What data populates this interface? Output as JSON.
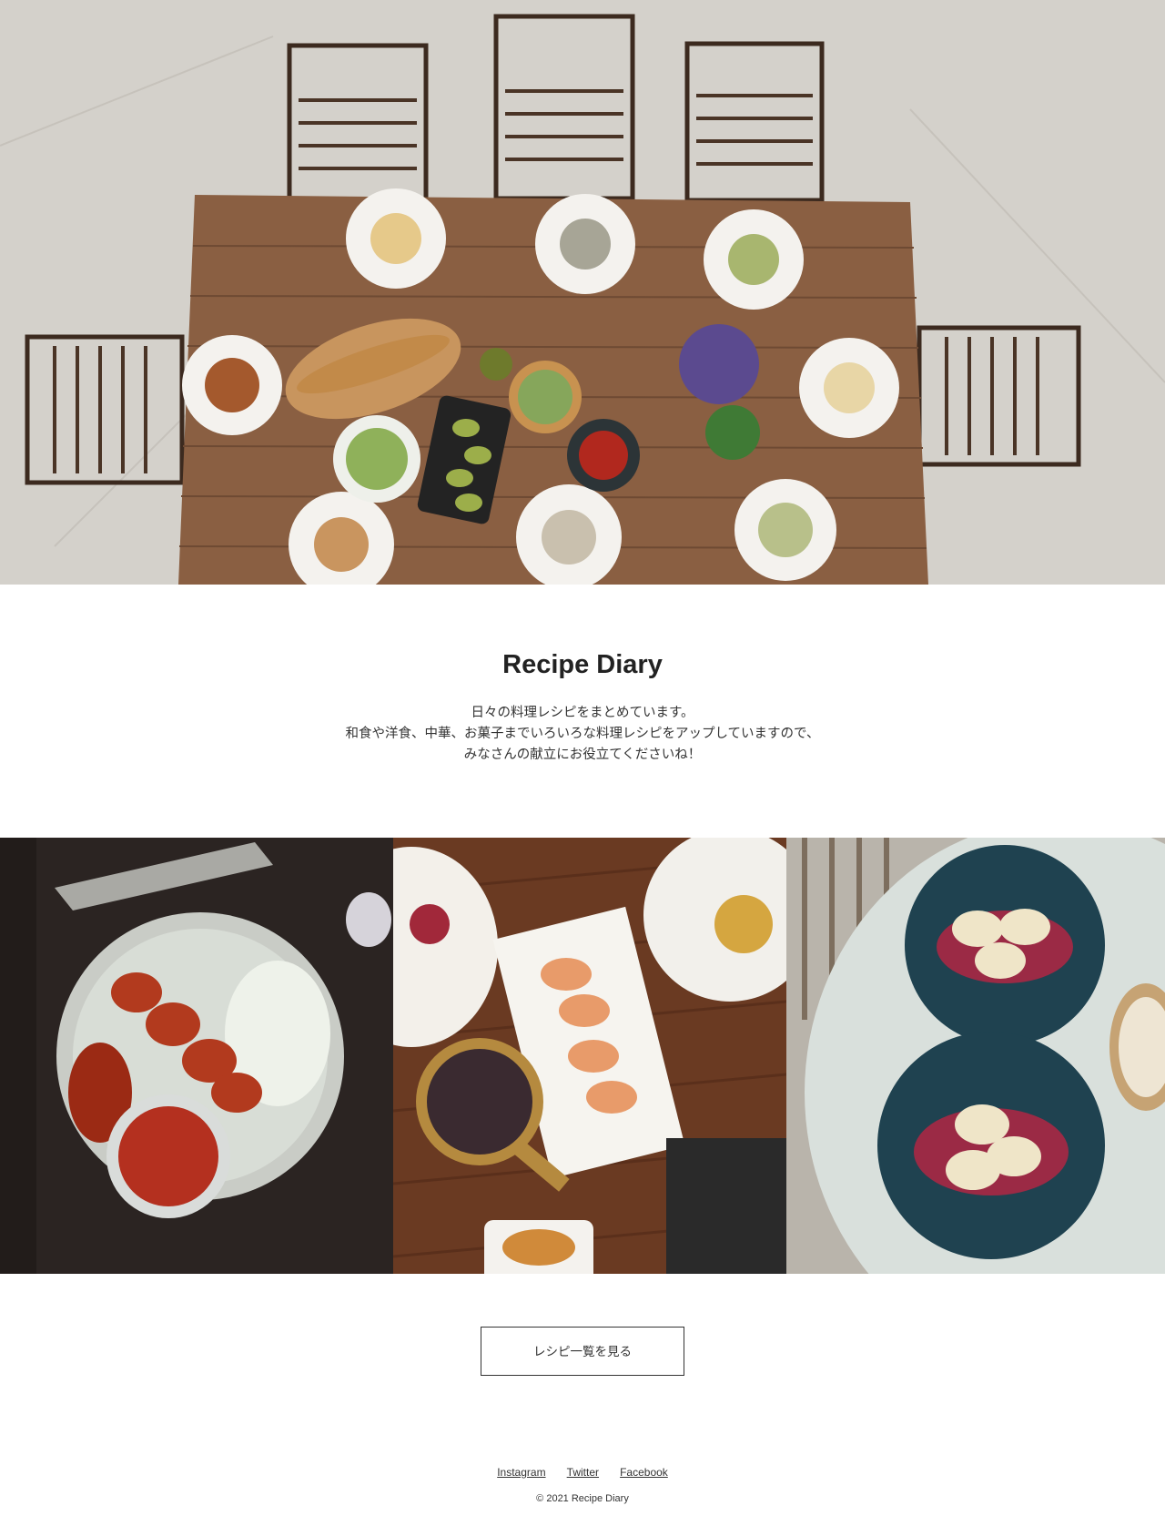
{
  "site": {
    "title": "Recipe Diary",
    "intro": [
      "日々の料理レシピをまとめています。",
      "和食や洋食、中華、お菓子までいろいろな料理レシピをアップしていますので、",
      "みなさんの献立にお役立てくださいね！"
    ]
  },
  "hero": {
    "image": "dining-table-photo"
  },
  "gallery": [
    {
      "image": "kebab-plate-photo"
    },
    {
      "image": "shrimp-platter-photo"
    },
    {
      "image": "ravioli-plates-photo"
    }
  ],
  "button": {
    "label": "レシピ一覧を見る"
  },
  "footer": {
    "links": [
      "Instagram",
      "Twitter",
      "Facebook"
    ],
    "copyright": "© 2021 Recipe Diary"
  },
  "colors": {
    "text": "#222222",
    "background": "#ffffff",
    "button_border": "#333333"
  }
}
